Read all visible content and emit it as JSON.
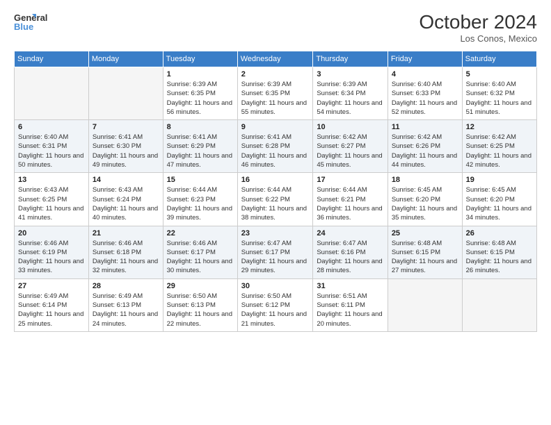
{
  "logo": {
    "line1": "General",
    "line2": "Blue"
  },
  "title": "October 2024",
  "subtitle": "Los Conos, Mexico",
  "days_header": [
    "Sunday",
    "Monday",
    "Tuesday",
    "Wednesday",
    "Thursday",
    "Friday",
    "Saturday"
  ],
  "weeks": [
    [
      {
        "day": "",
        "info": ""
      },
      {
        "day": "",
        "info": ""
      },
      {
        "day": "1",
        "info": "Sunrise: 6:39 AM\nSunset: 6:35 PM\nDaylight: 11 hours and 56 minutes."
      },
      {
        "day": "2",
        "info": "Sunrise: 6:39 AM\nSunset: 6:35 PM\nDaylight: 11 hours and 55 minutes."
      },
      {
        "day": "3",
        "info": "Sunrise: 6:39 AM\nSunset: 6:34 PM\nDaylight: 11 hours and 54 minutes."
      },
      {
        "day": "4",
        "info": "Sunrise: 6:40 AM\nSunset: 6:33 PM\nDaylight: 11 hours and 52 minutes."
      },
      {
        "day": "5",
        "info": "Sunrise: 6:40 AM\nSunset: 6:32 PM\nDaylight: 11 hours and 51 minutes."
      }
    ],
    [
      {
        "day": "6",
        "info": "Sunrise: 6:40 AM\nSunset: 6:31 PM\nDaylight: 11 hours and 50 minutes."
      },
      {
        "day": "7",
        "info": "Sunrise: 6:41 AM\nSunset: 6:30 PM\nDaylight: 11 hours and 49 minutes."
      },
      {
        "day": "8",
        "info": "Sunrise: 6:41 AM\nSunset: 6:29 PM\nDaylight: 11 hours and 47 minutes."
      },
      {
        "day": "9",
        "info": "Sunrise: 6:41 AM\nSunset: 6:28 PM\nDaylight: 11 hours and 46 minutes."
      },
      {
        "day": "10",
        "info": "Sunrise: 6:42 AM\nSunset: 6:27 PM\nDaylight: 11 hours and 45 minutes."
      },
      {
        "day": "11",
        "info": "Sunrise: 6:42 AM\nSunset: 6:26 PM\nDaylight: 11 hours and 44 minutes."
      },
      {
        "day": "12",
        "info": "Sunrise: 6:42 AM\nSunset: 6:25 PM\nDaylight: 11 hours and 42 minutes."
      }
    ],
    [
      {
        "day": "13",
        "info": "Sunrise: 6:43 AM\nSunset: 6:25 PM\nDaylight: 11 hours and 41 minutes."
      },
      {
        "day": "14",
        "info": "Sunrise: 6:43 AM\nSunset: 6:24 PM\nDaylight: 11 hours and 40 minutes."
      },
      {
        "day": "15",
        "info": "Sunrise: 6:44 AM\nSunset: 6:23 PM\nDaylight: 11 hours and 39 minutes."
      },
      {
        "day": "16",
        "info": "Sunrise: 6:44 AM\nSunset: 6:22 PM\nDaylight: 11 hours and 38 minutes."
      },
      {
        "day": "17",
        "info": "Sunrise: 6:44 AM\nSunset: 6:21 PM\nDaylight: 11 hours and 36 minutes."
      },
      {
        "day": "18",
        "info": "Sunrise: 6:45 AM\nSunset: 6:20 PM\nDaylight: 11 hours and 35 minutes."
      },
      {
        "day": "19",
        "info": "Sunrise: 6:45 AM\nSunset: 6:20 PM\nDaylight: 11 hours and 34 minutes."
      }
    ],
    [
      {
        "day": "20",
        "info": "Sunrise: 6:46 AM\nSunset: 6:19 PM\nDaylight: 11 hours and 33 minutes."
      },
      {
        "day": "21",
        "info": "Sunrise: 6:46 AM\nSunset: 6:18 PM\nDaylight: 11 hours and 32 minutes."
      },
      {
        "day": "22",
        "info": "Sunrise: 6:46 AM\nSunset: 6:17 PM\nDaylight: 11 hours and 30 minutes."
      },
      {
        "day": "23",
        "info": "Sunrise: 6:47 AM\nSunset: 6:17 PM\nDaylight: 11 hours and 29 minutes."
      },
      {
        "day": "24",
        "info": "Sunrise: 6:47 AM\nSunset: 6:16 PM\nDaylight: 11 hours and 28 minutes."
      },
      {
        "day": "25",
        "info": "Sunrise: 6:48 AM\nSunset: 6:15 PM\nDaylight: 11 hours and 27 minutes."
      },
      {
        "day": "26",
        "info": "Sunrise: 6:48 AM\nSunset: 6:15 PM\nDaylight: 11 hours and 26 minutes."
      }
    ],
    [
      {
        "day": "27",
        "info": "Sunrise: 6:49 AM\nSunset: 6:14 PM\nDaylight: 11 hours and 25 minutes."
      },
      {
        "day": "28",
        "info": "Sunrise: 6:49 AM\nSunset: 6:13 PM\nDaylight: 11 hours and 24 minutes."
      },
      {
        "day": "29",
        "info": "Sunrise: 6:50 AM\nSunset: 6:13 PM\nDaylight: 11 hours and 22 minutes."
      },
      {
        "day": "30",
        "info": "Sunrise: 6:50 AM\nSunset: 6:12 PM\nDaylight: 11 hours and 21 minutes."
      },
      {
        "day": "31",
        "info": "Sunrise: 6:51 AM\nSunset: 6:11 PM\nDaylight: 11 hours and 20 minutes."
      },
      {
        "day": "",
        "info": ""
      },
      {
        "day": "",
        "info": ""
      }
    ]
  ]
}
